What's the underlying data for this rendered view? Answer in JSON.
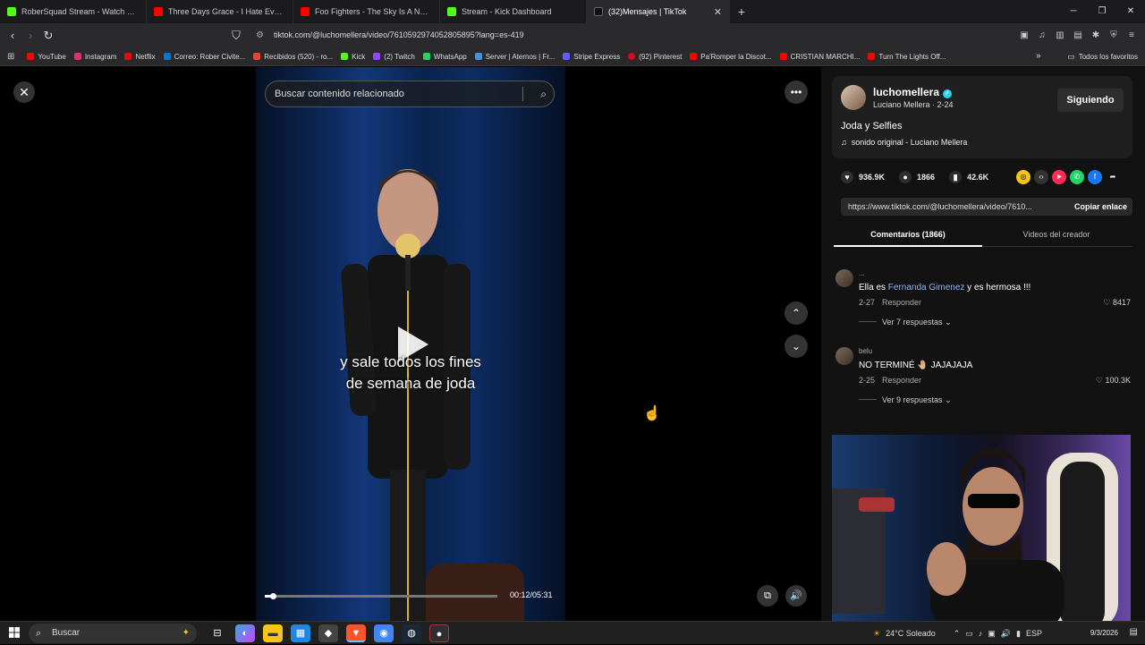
{
  "browser": {
    "tabs": [
      {
        "title": "RoberSquad Stream - Watch Live",
        "color": "#53fc18"
      },
      {
        "title": "Three Days Grace - I Hate Everything",
        "color": "#ff0000"
      },
      {
        "title": "Foo Fighters - The Sky Is A Neighbor",
        "color": "#ff0000"
      },
      {
        "title": "Stream - Kick Dashboard",
        "color": "#53fc18"
      },
      {
        "title": "(32)Mensajes | TikTok",
        "color": "#111111",
        "active": true
      }
    ],
    "url": "tiktok.com/@luchomellera/video/7610592974052805895?lang=es-419",
    "bookmarks": [
      {
        "label": "YouTube",
        "color": "#ff0000"
      },
      {
        "label": "Instagram",
        "color": "#e1306c"
      },
      {
        "label": "Netflix",
        "color": "#e50914"
      },
      {
        "label": "Correo: Rober Civite...",
        "color": "#0078d4"
      },
      {
        "label": "Recibidos (520) - ro...",
        "color": "#ffffff"
      },
      {
        "label": "Kick",
        "color": "#53fc18"
      },
      {
        "label": "(2) Twitch",
        "color": "#9146ff"
      },
      {
        "label": "WhatsApp",
        "color": "#25d366"
      },
      {
        "label": "Server | Aternos | Fr...",
        "color": "#4a90d9"
      },
      {
        "label": "Stripe Express",
        "color": "#635bff"
      },
      {
        "label": "(92) Pinterest",
        "color": "#e60023"
      },
      {
        "label": "Pa'Romper la Discot...",
        "color": "#ff0000"
      },
      {
        "label": "CRISTIAN MARCHI...",
        "color": "#ff0000"
      },
      {
        "label": "Turn The Lights Off...",
        "color": "#ff0000"
      }
    ],
    "all_bookmarks": "Todos los favoritos"
  },
  "video": {
    "search_placeholder": "Buscar contenido relacionado",
    "subtitle_line1": "y sale todos los fines",
    "subtitle_line2": "de semana de joda",
    "time": "00:12/05:31",
    "progress": 0.036
  },
  "creator": {
    "handle": "luchomellera",
    "meta": "Luciano Mellera · 2-24",
    "follow_label": "Siguiendo",
    "description": "Joda y Selfies",
    "music": "sonido original - Luciano Mellera"
  },
  "stats": {
    "likes": "936.9K",
    "comments": "1866",
    "saves": "42.6K"
  },
  "link": {
    "url": "https://www.tiktok.com/@luchomellera/video/7610...",
    "copy_label": "Copiar enlace"
  },
  "tabs": {
    "comments": "Comentarios (1866)",
    "creator_videos": "Videos del creador"
  },
  "comments": [
    {
      "name": "...",
      "text_before": "Ella es ",
      "mention": "Fernanda Gimenez",
      "text_after": " y es hermosa !!!",
      "date": "2-27",
      "reply": "Responder",
      "likes": "8417",
      "replies": "Ver 7 respuestas"
    },
    {
      "name": "belu",
      "text_before": "NO TERMINÉ 🤚🏼 JAJAJAJA",
      "mention": "",
      "text_after": "",
      "date": "2-25",
      "reply": "Responder",
      "likes": "100.3K",
      "replies": "Ver 9 respuestas"
    }
  ],
  "taskbar": {
    "search_label": "Buscar",
    "weather": "24°C  Soleado",
    "lang": "ESP",
    "time": "",
    "date": "9/3/2026"
  }
}
